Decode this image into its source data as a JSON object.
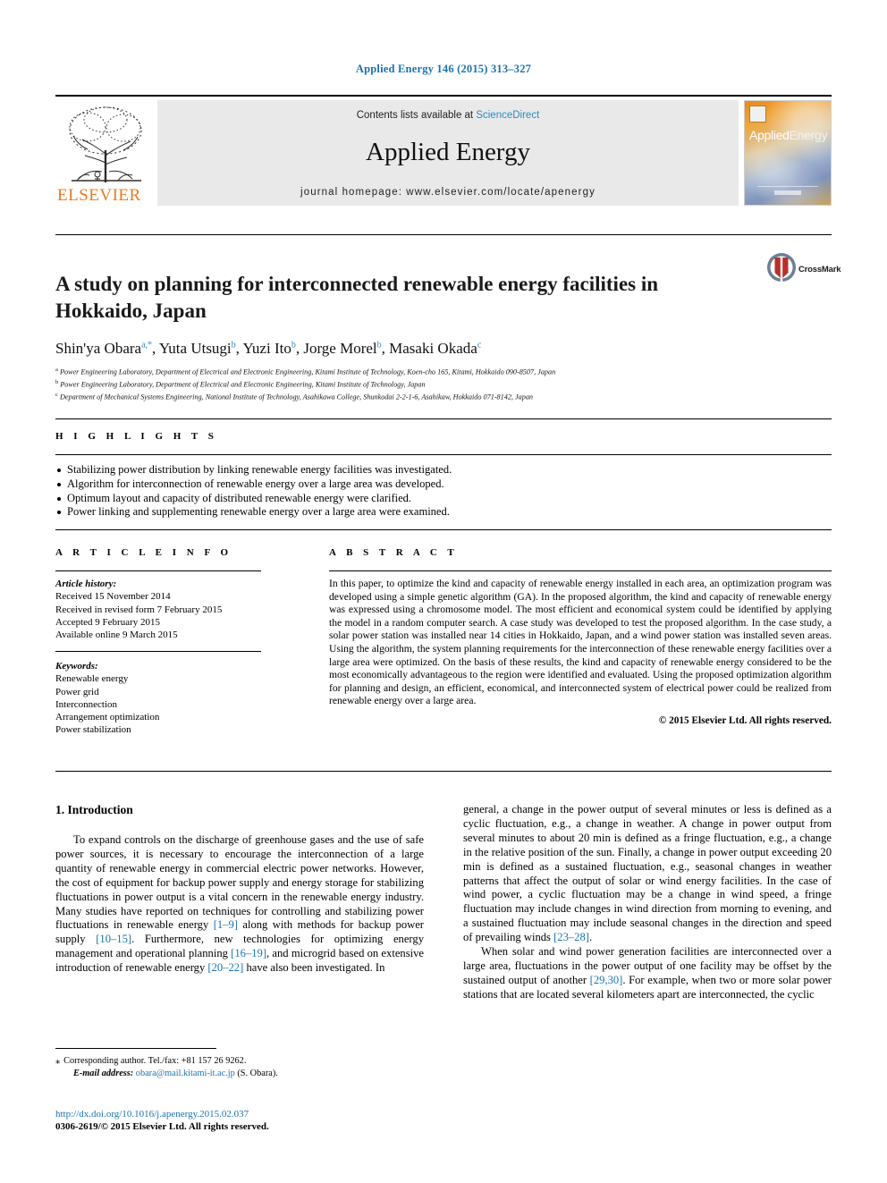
{
  "running_head": "Applied Energy 146 (2015) 313–327",
  "masthead": {
    "publisher_name": "ELSEVIER",
    "contents_prefix": "Contents lists available at",
    "contents_link": "ScienceDirect",
    "journal_title": "Applied Energy",
    "homepage": "journal homepage: www.elsevier.com/locate/apenergy",
    "cover_title_a": "Applied",
    "cover_title_b": "Energy"
  },
  "article": {
    "title": "A study on planning for interconnected renewable energy facilities in Hokkaido, Japan",
    "crossmark_label": "CrossMark",
    "authors": [
      {
        "name": "Shin'ya Obara",
        "marks": "a,*",
        "sep": ", "
      },
      {
        "name": "Yuta Utsugi",
        "marks": "b",
        "sep": ", "
      },
      {
        "name": "Yuzi Ito",
        "marks": "b",
        "sep": ", "
      },
      {
        "name": "Jorge Morel",
        "marks": "b",
        "sep": ", "
      },
      {
        "name": "Masaki Okada",
        "marks": "c",
        "sep": ""
      }
    ],
    "affiliations": [
      {
        "mark": "a",
        "text": "Power Engineering Laboratory, Department of Electrical and Electronic Engineering, Kitami Institute of Technology, Koen-cho 165, Kitami, Hokkaido 090-8507, Japan"
      },
      {
        "mark": "b",
        "text": "Power Engineering Laboratory, Department of Electrical and Electronic Engineering, Kitami Institute of Technology, Japan"
      },
      {
        "mark": "c",
        "text": "Department of Mechanical Systems Engineering, National Institute of Technology, Asahikawa College, Shunkodai 2-2-1-6, Asahikaw, Hokkaido 071-8142, Japan"
      }
    ]
  },
  "highlights": {
    "heading": "H I G H L I G H T S",
    "items": [
      "Stabilizing power distribution by linking renewable energy facilities was investigated.",
      "Algorithm for interconnection of renewable energy over a large area was developed.",
      "Optimum layout and capacity of distributed renewable energy were clarified.",
      "Power linking and supplementing renewable energy over a large area were examined."
    ]
  },
  "article_info": {
    "heading": "A R T I C L E    I N F O",
    "history_label": "Article history:",
    "history": [
      "Received 15 November 2014",
      "Received in revised form 7 February 2015",
      "Accepted 9 February 2015",
      "Available online 9 March 2015"
    ],
    "keywords_label": "Keywords:",
    "keywords": [
      "Renewable energy",
      "Power grid",
      "Interconnection",
      "Arrangement optimization",
      "Power stabilization"
    ]
  },
  "abstract": {
    "heading": "A B S T R A C T",
    "text": "In this paper, to optimize the kind and capacity of renewable energy installed in each area, an optimization program was developed using a simple genetic algorithm (GA). In the proposed algorithm, the kind and capacity of renewable energy was expressed using a chromosome model. The most efficient and economical system could be identified by applying the model in a random computer search. A case study was developed to test the proposed algorithm. In the case study, a solar power station was installed near 14 cities in Hokkaido, Japan, and a wind power station was installed seven areas. Using the algorithm, the system planning requirements for the interconnection of these renewable energy facilities over a large area were optimized. On the basis of these results, the kind and capacity of renewable energy considered to be the most economically advantageous to the region were identified and evaluated. Using the proposed optimization algorithm for planning and design, an efficient, economical, and interconnected system of electrical power could be realized from renewable energy over a large area.",
    "copyright": "© 2015 Elsevier Ltd. All rights reserved."
  },
  "body": {
    "section_title": "1. Introduction",
    "left_paragraph_1_a": "To expand controls on the discharge of greenhouse gases and the use of safe power sources, it is necessary to encourage the interconnection of a large quantity of renewable energy in commercial electric power networks. However, the cost of equipment for backup power supply and energy storage for stabilizing fluctuations in power output is a vital concern in the renewable energy industry. Many studies have reported on techniques for controlling and stabilizing power fluctuations in renewable energy ",
    "ref_1_9": "[1–9]",
    "left_paragraph_1_b": " along with methods for backup power supply ",
    "ref_10_15": "[10–15]",
    "left_paragraph_1_c": ". Furthermore, new technologies for optimizing energy management and operational planning ",
    "ref_16_19": "[16–19]",
    "left_paragraph_1_d": ", and microgrid based on extensive introduction of renewable energy ",
    "ref_20_22": "[20–22]",
    "left_paragraph_1_e": " have also been investigated. In",
    "right_paragraph_1_a": "general, a change in the power output of several minutes or less is defined as a cyclic fluctuation, e.g., a change in weather. A change in power output from several minutes to about 20 min is defined as a fringe fluctuation, e.g., a change in the relative position of the sun. Finally, a change in power output exceeding 20 min is defined as a sustained fluctuation, e.g., seasonal changes in weather patterns that affect the output of solar or wind energy facilities. In the case of wind power, a cyclic fluctuation may be a change in wind speed, a fringe fluctuation may include changes in wind direction from morning to evening, and a sustained fluctuation may include seasonal changes in the direction and speed of prevailing winds ",
    "ref_23_28": "[23–28]",
    "right_paragraph_1_b": ".",
    "right_paragraph_2_a": "When solar and wind power generation facilities are interconnected over a large area, fluctuations in the power output of one facility may be offset by the sustained output of another ",
    "ref_29_30": "[29,30]",
    "right_paragraph_2_b": ". For example, when two or more solar power stations that are located several kilometers apart are interconnected, the cyclic"
  },
  "footnotes": {
    "corresponding": "Corresponding author. Tel./fax: +81 157 26 9262.",
    "email_label": "E-mail address:",
    "email": "obara@mail.kitami-it.ac.jp",
    "email_owner": "(S. Obara).",
    "doi": "http://dx.doi.org/10.1016/j.apenergy.2015.02.037",
    "issn": "0306-2619/© 2015 Elsevier Ltd. All rights reserved."
  },
  "colors": {
    "link": "#1a72b0",
    "sciencedirect": "#2b8bbd",
    "elsevier_orange": "#e87a1e",
    "band_grey": "#e9e9e9"
  }
}
